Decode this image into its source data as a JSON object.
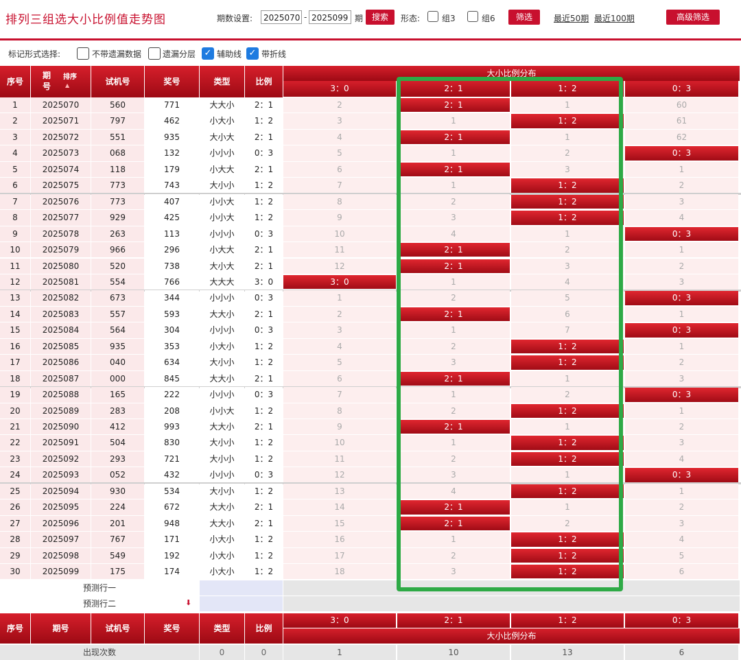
{
  "header": {
    "title": "排列三组选大小比例值走势图",
    "period_label": "期数设置:",
    "period_start": "2025070",
    "dash": "-",
    "period_end": "2025099",
    "period_unit": "期",
    "search_button": "搜索",
    "form_label": "形态:",
    "group3_label": "组3",
    "group6_label": "组6",
    "filter_button": "筛选",
    "recent50": "最近50期",
    "recent100": "最近100期",
    "advanced_button": "高级筛选"
  },
  "markbar": {
    "label": "标记形式选择:",
    "opt_no_missing": "不带遗漏数据",
    "opt_missing_layer": "遗漏分层",
    "opt_aux_line": "辅助线",
    "opt_polyline": "带折线",
    "aux_checked": true,
    "polyline_checked": true
  },
  "table": {
    "headers": {
      "seq": "序号",
      "period": "期号",
      "sort": "排序",
      "trial": "试机号",
      "prize": "奖号",
      "type": "类型",
      "ratio": "比例",
      "dist_title": "大小比例分布"
    },
    "ratio_cols": [
      "3：0",
      "2：1",
      "1：2",
      "0：3"
    ],
    "rows": [
      {
        "seq": "1",
        "period": "2025070",
        "trial": "560",
        "prize": "771",
        "type": "大大小",
        "ratio": "2：1",
        "d": [
          "2",
          "2：1",
          "1",
          "60"
        ],
        "hit": 1
      },
      {
        "seq": "2",
        "period": "2025071",
        "trial": "797",
        "prize": "462",
        "type": "小大小",
        "ratio": "1：2",
        "d": [
          "3",
          "1",
          "1：2",
          "61"
        ],
        "hit": 2
      },
      {
        "seq": "3",
        "period": "2025072",
        "trial": "551",
        "prize": "935",
        "type": "大小大",
        "ratio": "2：1",
        "d": [
          "4",
          "2：1",
          "1",
          "62"
        ],
        "hit": 1
      },
      {
        "seq": "4",
        "period": "2025073",
        "trial": "068",
        "prize": "132",
        "type": "小小小",
        "ratio": "0：3",
        "d": [
          "5",
          "1",
          "2",
          "0：3"
        ],
        "hit": 3
      },
      {
        "seq": "5",
        "period": "2025074",
        "trial": "118",
        "prize": "179",
        "type": "小大大",
        "ratio": "2：1",
        "d": [
          "6",
          "2：1",
          "3",
          "1"
        ],
        "hit": 1
      },
      {
        "seq": "6",
        "period": "2025075",
        "trial": "773",
        "prize": "743",
        "type": "大小小",
        "ratio": "1：2",
        "d": [
          "7",
          "1",
          "1：2",
          "2"
        ],
        "hit": 2
      },
      {
        "seq": "7",
        "period": "2025076",
        "trial": "773",
        "prize": "407",
        "type": "小小大",
        "ratio": "1：2",
        "d": [
          "8",
          "2",
          "1：2",
          "3"
        ],
        "hit": 2
      },
      {
        "seq": "8",
        "period": "2025077",
        "trial": "929",
        "prize": "425",
        "type": "小小大",
        "ratio": "1：2",
        "d": [
          "9",
          "3",
          "1：2",
          "4"
        ],
        "hit": 2
      },
      {
        "seq": "9",
        "period": "2025078",
        "trial": "263",
        "prize": "113",
        "type": "小小小",
        "ratio": "0：3",
        "d": [
          "10",
          "4",
          "1",
          "0：3"
        ],
        "hit": 3
      },
      {
        "seq": "10",
        "period": "2025079",
        "trial": "966",
        "prize": "296",
        "type": "小大大",
        "ratio": "2：1",
        "d": [
          "11",
          "2：1",
          "2",
          "1"
        ],
        "hit": 1
      },
      {
        "seq": "11",
        "period": "2025080",
        "trial": "520",
        "prize": "738",
        "type": "大小大",
        "ratio": "2：1",
        "d": [
          "12",
          "2：1",
          "3",
          "2"
        ],
        "hit": 1
      },
      {
        "seq": "12",
        "period": "2025081",
        "trial": "554",
        "prize": "766",
        "type": "大大大",
        "ratio": "3：0",
        "d": [
          "3：0",
          "1",
          "4",
          "3"
        ],
        "hit": 0
      },
      {
        "seq": "13",
        "period": "2025082",
        "trial": "673",
        "prize": "344",
        "type": "小小小",
        "ratio": "0：3",
        "d": [
          "1",
          "2",
          "5",
          "0：3"
        ],
        "hit": 3
      },
      {
        "seq": "14",
        "period": "2025083",
        "trial": "557",
        "prize": "593",
        "type": "大大小",
        "ratio": "2：1",
        "d": [
          "2",
          "2：1",
          "6",
          "1"
        ],
        "hit": 1
      },
      {
        "seq": "15",
        "period": "2025084",
        "trial": "564",
        "prize": "304",
        "type": "小小小",
        "ratio": "0：3",
        "d": [
          "3",
          "1",
          "7",
          "0：3"
        ],
        "hit": 3
      },
      {
        "seq": "16",
        "period": "2025085",
        "trial": "935",
        "prize": "353",
        "type": "小大小",
        "ratio": "1：2",
        "d": [
          "4",
          "2",
          "1：2",
          "1"
        ],
        "hit": 2
      },
      {
        "seq": "17",
        "period": "2025086",
        "trial": "040",
        "prize": "634",
        "type": "大小小",
        "ratio": "1：2",
        "d": [
          "5",
          "3",
          "1：2",
          "2"
        ],
        "hit": 2
      },
      {
        "seq": "18",
        "period": "2025087",
        "trial": "000",
        "prize": "845",
        "type": "大大小",
        "ratio": "2：1",
        "d": [
          "6",
          "2：1",
          "1",
          "3"
        ],
        "hit": 1
      },
      {
        "seq": "19",
        "period": "2025088",
        "trial": "165",
        "prize": "222",
        "type": "小小小",
        "ratio": "0：3",
        "d": [
          "7",
          "1",
          "2",
          "0：3"
        ],
        "hit": 3
      },
      {
        "seq": "20",
        "period": "2025089",
        "trial": "283",
        "prize": "208",
        "type": "小小大",
        "ratio": "1：2",
        "d": [
          "8",
          "2",
          "1：2",
          "1"
        ],
        "hit": 2
      },
      {
        "seq": "21",
        "period": "2025090",
        "trial": "412",
        "prize": "993",
        "type": "大大小",
        "ratio": "2：1",
        "d": [
          "9",
          "2：1",
          "1",
          "2"
        ],
        "hit": 1
      },
      {
        "seq": "22",
        "period": "2025091",
        "trial": "504",
        "prize": "830",
        "type": "大小小",
        "ratio": "1：2",
        "d": [
          "10",
          "1",
          "1：2",
          "3"
        ],
        "hit": 2
      },
      {
        "seq": "23",
        "period": "2025092",
        "trial": "293",
        "prize": "721",
        "type": "大小小",
        "ratio": "1：2",
        "d": [
          "11",
          "2",
          "1：2",
          "4"
        ],
        "hit": 2
      },
      {
        "seq": "24",
        "period": "2025093",
        "trial": "052",
        "prize": "432",
        "type": "小小小",
        "ratio": "0：3",
        "d": [
          "12",
          "3",
          "1",
          "0：3"
        ],
        "hit": 3
      },
      {
        "seq": "25",
        "period": "2025094",
        "trial": "930",
        "prize": "534",
        "type": "大小小",
        "ratio": "1：2",
        "d": [
          "13",
          "4",
          "1：2",
          "1"
        ],
        "hit": 2
      },
      {
        "seq": "26",
        "period": "2025095",
        "trial": "224",
        "prize": "672",
        "type": "大大小",
        "ratio": "2：1",
        "d": [
          "14",
          "2：1",
          "1",
          "2"
        ],
        "hit": 1
      },
      {
        "seq": "27",
        "period": "2025096",
        "trial": "201",
        "prize": "948",
        "type": "大大小",
        "ratio": "2：1",
        "d": [
          "15",
          "2：1",
          "2",
          "3"
        ],
        "hit": 1
      },
      {
        "seq": "28",
        "period": "2025097",
        "trial": "767",
        "prize": "171",
        "type": "小大小",
        "ratio": "1：2",
        "d": [
          "16",
          "1",
          "1：2",
          "4"
        ],
        "hit": 2
      },
      {
        "seq": "29",
        "period": "2025098",
        "trial": "549",
        "prize": "192",
        "type": "小大小",
        "ratio": "1：2",
        "d": [
          "17",
          "2",
          "1：2",
          "5"
        ],
        "hit": 2
      },
      {
        "seq": "30",
        "period": "2025099",
        "trial": "175",
        "prize": "174",
        "type": "小大小",
        "ratio": "1：2",
        "d": [
          "18",
          "3",
          "1：2",
          "6"
        ],
        "hit": 2
      }
    ],
    "predict1": "预测行一",
    "predict2": "预测行二",
    "footer": {
      "count_label": "出现次数",
      "type_count": "0",
      "ratio_count": "0",
      "counts": [
        "1",
        "10",
        "13",
        "6"
      ]
    }
  },
  "colors": {
    "brand_red": "#c8102e",
    "highlight_green": "#2eaa46",
    "check_blue": "#1e7be0"
  }
}
